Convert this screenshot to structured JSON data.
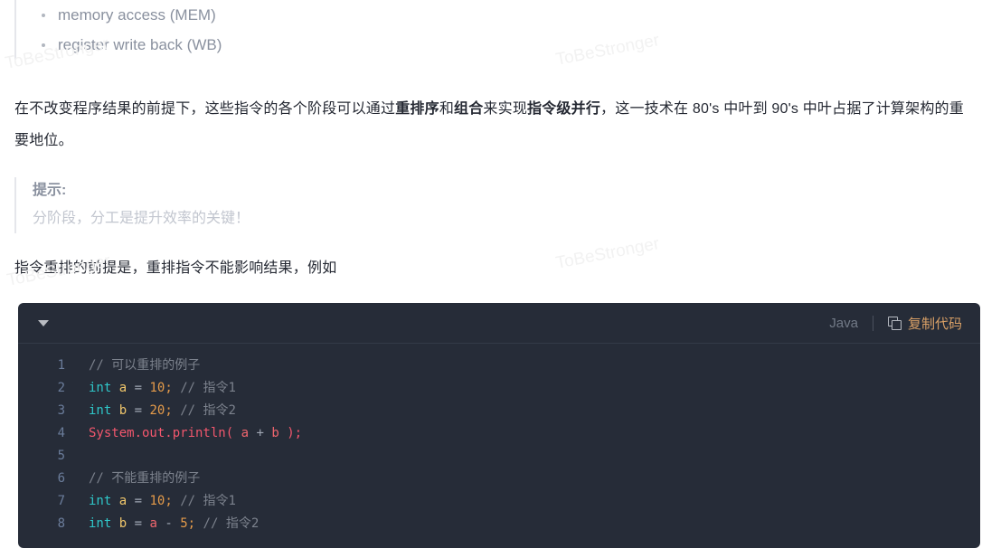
{
  "watermark": {
    "text": "ToBeStronger"
  },
  "quote_list": {
    "items": [
      "memory access (MEM)",
      "register write back (WB)"
    ]
  },
  "paragraph1": {
    "part1": "在不改变程序结果的前提下，这些指令的各个阶段可以通过",
    "bold1": "重排序",
    "part2": "和",
    "bold2": "组合",
    "part3": "来实现",
    "bold3": "指令级并行",
    "part4": "，这一技术在 80's 中叶到 90's 中叶占据了计算架构的重要地位。"
  },
  "tip": {
    "title": "提示:",
    "body": "分阶段，分工是提升效率的关键！"
  },
  "paragraph2": {
    "text": "指令重排的前提是，重排指令不能影响结果，例如"
  },
  "code_block": {
    "collapse_icon": "caret-down-icon",
    "language": "Java",
    "copy_icon": "copy-icon",
    "copy_label": "复制代码",
    "lines": [
      {
        "n": "1",
        "tokens": [
          {
            "t": "// 可以重排的例子",
            "c": "t-comment"
          }
        ]
      },
      {
        "n": "2",
        "tokens": [
          {
            "t": "int",
            "c": "t-kw"
          },
          {
            "t": " ",
            "c": "t-op"
          },
          {
            "t": "a",
            "c": "t-var"
          },
          {
            "t": " ",
            "c": "t-op"
          },
          {
            "t": "=",
            "c": "t-op"
          },
          {
            "t": " ",
            "c": "t-op"
          },
          {
            "t": "10",
            "c": "t-num"
          },
          {
            "t": ";",
            "c": "t-punc"
          },
          {
            "t": " ",
            "c": "t-op"
          },
          {
            "t": "// 指令1",
            "c": "t-comment"
          }
        ]
      },
      {
        "n": "3",
        "tokens": [
          {
            "t": "int",
            "c": "t-kw"
          },
          {
            "t": " ",
            "c": "t-op"
          },
          {
            "t": "b",
            "c": "t-var"
          },
          {
            "t": " ",
            "c": "t-op"
          },
          {
            "t": "=",
            "c": "t-op"
          },
          {
            "t": " ",
            "c": "t-op"
          },
          {
            "t": "20",
            "c": "t-num"
          },
          {
            "t": ";",
            "c": "t-punc"
          },
          {
            "t": " ",
            "c": "t-op"
          },
          {
            "t": "// 指令2",
            "c": "t-comment"
          }
        ]
      },
      {
        "n": "4",
        "tokens": [
          {
            "t": "System.out.println(",
            "c": "t-fn"
          },
          {
            "t": " ",
            "c": "t-op"
          },
          {
            "t": "a",
            "c": "t-ref"
          },
          {
            "t": " ",
            "c": "t-op"
          },
          {
            "t": "+",
            "c": "t-op"
          },
          {
            "t": " ",
            "c": "t-op"
          },
          {
            "t": "b",
            "c": "t-ref"
          },
          {
            "t": " ",
            "c": "t-op"
          },
          {
            "t": ");",
            "c": "t-fn"
          }
        ]
      },
      {
        "n": "5",
        "tokens": [
          {
            "t": "",
            "c": "t-op"
          }
        ]
      },
      {
        "n": "6",
        "tokens": [
          {
            "t": "// 不能重排的例子",
            "c": "t-comment"
          }
        ]
      },
      {
        "n": "7",
        "tokens": [
          {
            "t": "int",
            "c": "t-kw"
          },
          {
            "t": " ",
            "c": "t-op"
          },
          {
            "t": "a",
            "c": "t-var"
          },
          {
            "t": " ",
            "c": "t-op"
          },
          {
            "t": "=",
            "c": "t-op"
          },
          {
            "t": " ",
            "c": "t-op"
          },
          {
            "t": "10",
            "c": "t-num"
          },
          {
            "t": ";",
            "c": "t-punc"
          },
          {
            "t": " ",
            "c": "t-op"
          },
          {
            "t": "// 指令1",
            "c": "t-comment"
          }
        ]
      },
      {
        "n": "8",
        "tokens": [
          {
            "t": "int",
            "c": "t-kw"
          },
          {
            "t": " ",
            "c": "t-op"
          },
          {
            "t": "b",
            "c": "t-var"
          },
          {
            "t": " ",
            "c": "t-op"
          },
          {
            "t": "=",
            "c": "t-op"
          },
          {
            "t": " ",
            "c": "t-op"
          },
          {
            "t": "a",
            "c": "t-ref"
          },
          {
            "t": " ",
            "c": "t-op"
          },
          {
            "t": "-",
            "c": "t-op"
          },
          {
            "t": " ",
            "c": "t-op"
          },
          {
            "t": "5",
            "c": "t-num"
          },
          {
            "t": ";",
            "c": "t-punc"
          },
          {
            "t": " ",
            "c": "t-op"
          },
          {
            "t": "// 指令2",
            "c": "t-comment"
          }
        ]
      }
    ]
  },
  "colors": {
    "code_bg": "#262c38",
    "copy_accent": "#d9a066",
    "keyword": "#2fc7c9",
    "number": "#e59b4a",
    "function": "#f2576d",
    "comment": "#7c828d",
    "variable": "#f0c66b"
  }
}
